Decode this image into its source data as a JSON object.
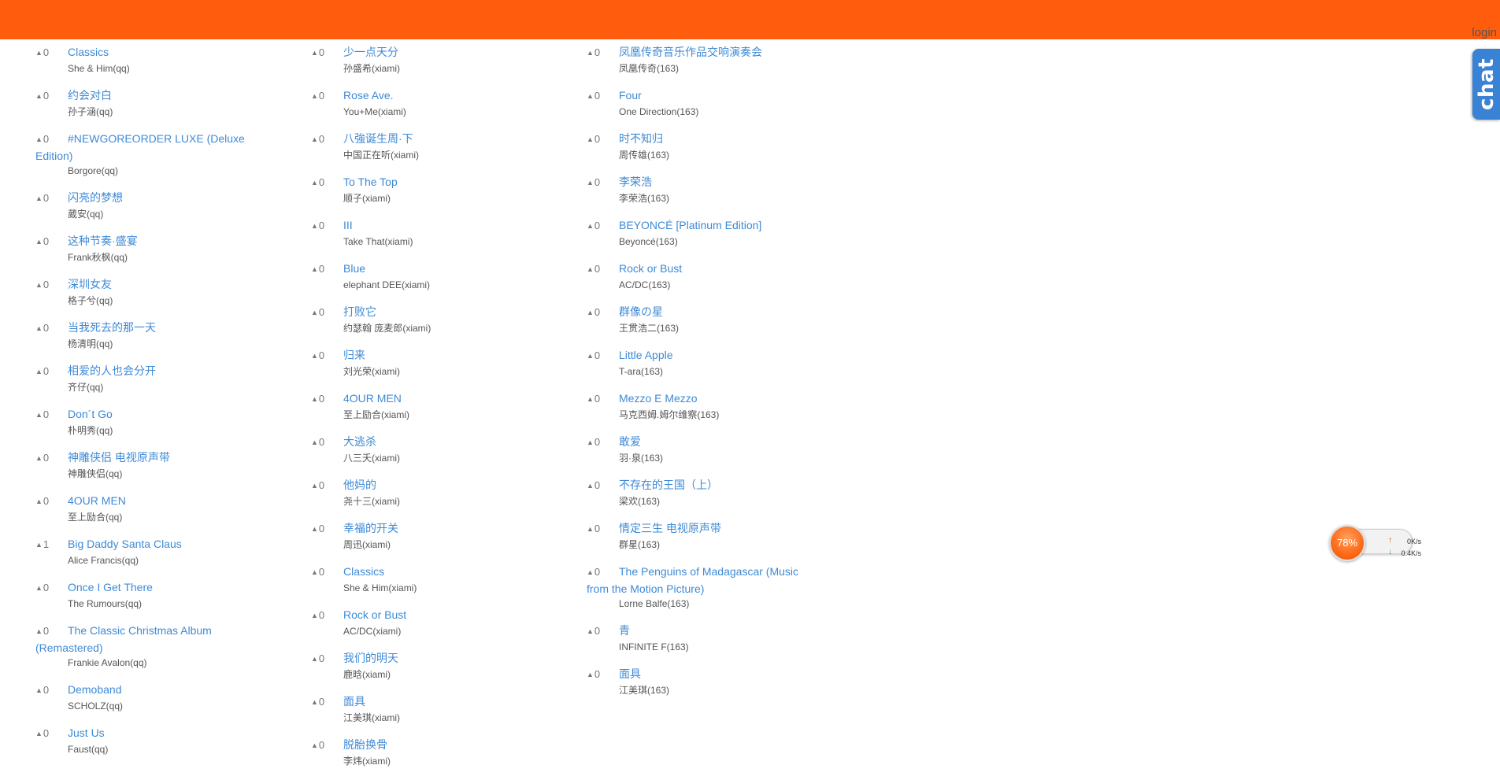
{
  "header": {
    "login_label": "login"
  },
  "chat_tab": {
    "label": "chat"
  },
  "speed_widget": {
    "percent": "78%",
    "upload": "0K/s",
    "download": "0.4K/s"
  },
  "columns": [
    [
      {
        "votes": "0",
        "title": "Classics",
        "artist": "She & Him(qq)"
      },
      {
        "votes": "0",
        "title": "约会对白",
        "artist": "孙子涵(qq)"
      },
      {
        "votes": "0",
        "title": "#NEWGOREORDER LUXE (Deluxe Edition)",
        "artist": "Borgore(qq)"
      },
      {
        "votes": "0",
        "title": "闪亮的梦想",
        "artist": "葳安(qq)"
      },
      {
        "votes": "0",
        "title": "这种节奏·盛宴",
        "artist": "Frank秋枫(qq)"
      },
      {
        "votes": "0",
        "title": "深圳女友",
        "artist": "格子兮(qq)"
      },
      {
        "votes": "0",
        "title": "当我死去的那一天",
        "artist": "杨清明(qq)"
      },
      {
        "votes": "0",
        "title": "相爱的人也会分开",
        "artist": "齐仔(qq)"
      },
      {
        "votes": "0",
        "title": "Don´t Go",
        "artist": "朴明秀(qq)"
      },
      {
        "votes": "0",
        "title": "神雕侠侣 电视原声带",
        "artist": "神雕侠侣(qq)"
      },
      {
        "votes": "0",
        "title": "4OUR MEN",
        "artist": "至上励合(qq)"
      },
      {
        "votes": "1",
        "title": "Big Daddy Santa Claus",
        "artist": "Alice Francis(qq)"
      },
      {
        "votes": "0",
        "title": "Once I Get There",
        "artist": "The Rumours(qq)"
      },
      {
        "votes": "0",
        "title": "The Classic Christmas Album (Remastered)",
        "artist": "Frankie Avalon(qq)"
      },
      {
        "votes": "0",
        "title": "Demoband",
        "artist": "SCHOLZ(qq)"
      },
      {
        "votes": "0",
        "title": "Just Us",
        "artist": "Faust(qq)"
      }
    ],
    [
      {
        "votes": "0",
        "title": "少一点天分",
        "artist": "孙盛希(xiami)"
      },
      {
        "votes": "0",
        "title": "Rose Ave.",
        "artist": "You+Me(xiami)"
      },
      {
        "votes": "0",
        "title": "八強诞生周·下",
        "artist": "中国正在听(xiami)"
      },
      {
        "votes": "0",
        "title": "To The Top",
        "artist": "顺子(xiami)"
      },
      {
        "votes": "0",
        "title": "III",
        "artist": "Take That(xiami)"
      },
      {
        "votes": "0",
        "title": "Blue",
        "artist": "elephant DEE(xiami)"
      },
      {
        "votes": "0",
        "title": "打败它",
        "artist": "约瑟翰 庞麦郎(xiami)"
      },
      {
        "votes": "0",
        "title": "归来",
        "artist": "刘光荣(xiami)"
      },
      {
        "votes": "0",
        "title": "4OUR MEN",
        "artist": "至上励合(xiami)"
      },
      {
        "votes": "0",
        "title": "大逃杀",
        "artist": "八三夭(xiami)"
      },
      {
        "votes": "0",
        "title": "他妈的",
        "artist": "尧十三(xiami)"
      },
      {
        "votes": "0",
        "title": "幸福的开关",
        "artist": "周迅(xiami)"
      },
      {
        "votes": "0",
        "title": "Classics",
        "artist": "She & Him(xiami)"
      },
      {
        "votes": "0",
        "title": "Rock or Bust",
        "artist": "AC/DC(xiami)"
      },
      {
        "votes": "0",
        "title": "我们的明天",
        "artist": "鹿晗(xiami)"
      },
      {
        "votes": "0",
        "title": "面具",
        "artist": "江美琪(xiami)"
      },
      {
        "votes": "0",
        "title": "脱胎换骨",
        "artist": "李炜(xiami)"
      }
    ],
    [
      {
        "votes": "0",
        "title": "凤凰传奇音乐作品交响演奏会",
        "artist": "凤凰传奇(163)"
      },
      {
        "votes": "0",
        "title": "Four",
        "artist": "One Direction(163)"
      },
      {
        "votes": "0",
        "title": "时不知归",
        "artist": "周传雄(163)"
      },
      {
        "votes": "0",
        "title": "李荣浩",
        "artist": "李荣浩(163)"
      },
      {
        "votes": "0",
        "title": "BEYONCÉ [Platinum Edition]",
        "artist": "Beyoncé(163)"
      },
      {
        "votes": "0",
        "title": "Rock or Bust",
        "artist": "AC/DC(163)"
      },
      {
        "votes": "0",
        "title": "群像の星",
        "artist": "王贯浩二(163)"
      },
      {
        "votes": "0",
        "title": "Little Apple",
        "artist": "T-ara(163)"
      },
      {
        "votes": "0",
        "title": "Mezzo E Mezzo",
        "artist": "马克西姆.姆尔维察(163)"
      },
      {
        "votes": "0",
        "title": "敢爱",
        "artist": "羽·泉(163)"
      },
      {
        "votes": "0",
        "title": "不存在的王国（上）",
        "artist": "梁欢(163)"
      },
      {
        "votes": "0",
        "title": "情定三生 电视原声带",
        "artist": "群星(163)"
      },
      {
        "votes": "0",
        "title": "The Penguins of Madagascar (Music from the Motion Picture)",
        "artist": "Lorne Balfe(163)"
      },
      {
        "votes": "0",
        "title": "青",
        "artist": "INFINITE F(163)"
      },
      {
        "votes": "0",
        "title": "面具",
        "artist": "江美琪(163)"
      }
    ]
  ]
}
